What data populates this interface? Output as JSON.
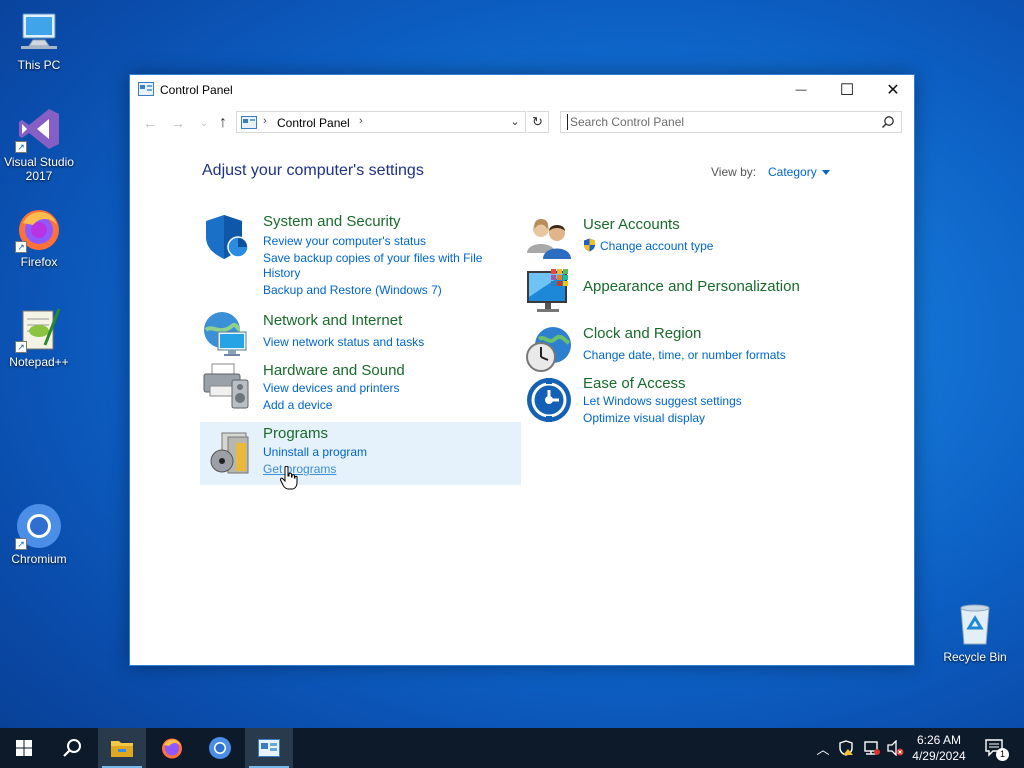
{
  "desktop": {
    "icons": [
      {
        "label": "This PC"
      },
      {
        "label": "Visual Studio 2017"
      },
      {
        "label": "Firefox"
      },
      {
        "label": "Notepad++"
      },
      {
        "label": "Chromium"
      },
      {
        "label": "Recycle Bin"
      }
    ]
  },
  "window": {
    "title": "Control Panel",
    "controls": {
      "minimize": "—",
      "maximize": "☐",
      "close": "✕"
    },
    "address": {
      "crumb": "Control Panel",
      "separator": "›"
    },
    "search": {
      "placeholder": "Search Control Panel"
    },
    "heading": "Adjust your computer's settings",
    "view_by": {
      "label": "View by:",
      "value": "Category"
    },
    "categories": [
      {
        "title": "System and Security",
        "icon": "shield-icon",
        "links": [
          "Review your computer's status",
          "Save backup copies of your files with File History",
          "Backup and Restore (Windows 7)"
        ]
      },
      {
        "title": "Network and Internet",
        "icon": "network-icon",
        "links": [
          "View network status and tasks"
        ]
      },
      {
        "title": "Hardware and Sound",
        "icon": "printer-icon",
        "links": [
          "View devices and printers",
          "Add a device"
        ]
      },
      {
        "title": "Programs",
        "icon": "programs-icon",
        "links": [
          "Uninstall a program",
          "Get programs"
        ]
      },
      {
        "title": "User Accounts",
        "icon": "users-icon",
        "links": [
          "Change account type"
        ]
      },
      {
        "title": "Appearance and Personalization",
        "icon": "monitor-icon",
        "links": []
      },
      {
        "title": "Clock and Region",
        "icon": "clock-globe-icon",
        "links": [
          "Change date, time, or number formats"
        ]
      },
      {
        "title": "Ease of Access",
        "icon": "ease-of-access-icon",
        "links": [
          "Let Windows suggest settings",
          "Optimize visual display"
        ]
      }
    ]
  },
  "taskbar": {
    "clock": {
      "time": "6:26 AM",
      "date": "4/29/2024"
    },
    "notification_count": "1"
  },
  "colors": {
    "category_title": "#1a6b2c",
    "link": "#0066cc",
    "heading": "#1e3287",
    "taskbar": "#0d1a2a"
  }
}
